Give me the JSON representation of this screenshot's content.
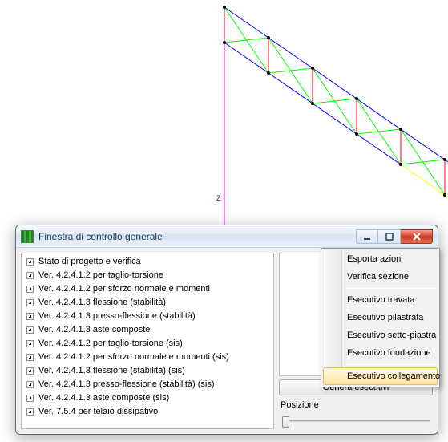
{
  "window": {
    "title": "Finestra di controllo generale"
  },
  "tree": {
    "items": [
      {
        "label": "Stato di progetto e verifica"
      },
      {
        "label": "Ver. 4.2.4.1.2 per taglio-torsione"
      },
      {
        "label": "Ver. 4.2.4.1.2 per sforzo normale e momenti"
      },
      {
        "label": "Ver. 4.2.4.1.3 flessione (stabilità)"
      },
      {
        "label": "Ver. 4.2.4.1.3 presso-flessione (stabilità)"
      },
      {
        "label": "Ver. 4.2.4.1.3 aste composte"
      },
      {
        "label": "Ver. 4.2.4.1.2 per taglio-torsione (sis)"
      },
      {
        "label": "Ver. 4.2.4.1.2 per sforzo normale e momenti (sis)"
      },
      {
        "label": "Ver. 4.2.4.1.3 flessione (stabilità) (sis)"
      },
      {
        "label": "Ver. 4.2.4.1.3 presso-flessione (stabilità) (sis)"
      },
      {
        "label": "Ver. 4.2.4.1.3 aste composte (sis)"
      },
      {
        "label": "Ver. 7.5.4   per telaio dissipativo"
      }
    ]
  },
  "buttons": {
    "genera": "Genera esecutivi"
  },
  "labels": {
    "posizione": "Posizione"
  },
  "context_menu": {
    "items": [
      {
        "label": "Esporta azioni",
        "type": "item"
      },
      {
        "label": "Verifica sezione",
        "type": "item"
      },
      {
        "type": "sep"
      },
      {
        "label": "Esecutivo travata",
        "type": "item"
      },
      {
        "label": "Esecutivo pilastrata",
        "type": "item"
      },
      {
        "label": "Esecutivo setto-piastra",
        "type": "item"
      },
      {
        "label": "Esecutivo fondazione",
        "type": "item"
      },
      {
        "type": "sep"
      },
      {
        "label": "Esecutivo collegamento",
        "type": "item",
        "highlighted": true
      }
    ]
  },
  "colors": {
    "truss_red": "#ff0000",
    "truss_green": "#00ff00",
    "truss_blue": "#0000ff",
    "truss_yellow": "#ffff00",
    "truss_magenta": "#ff00ff"
  }
}
